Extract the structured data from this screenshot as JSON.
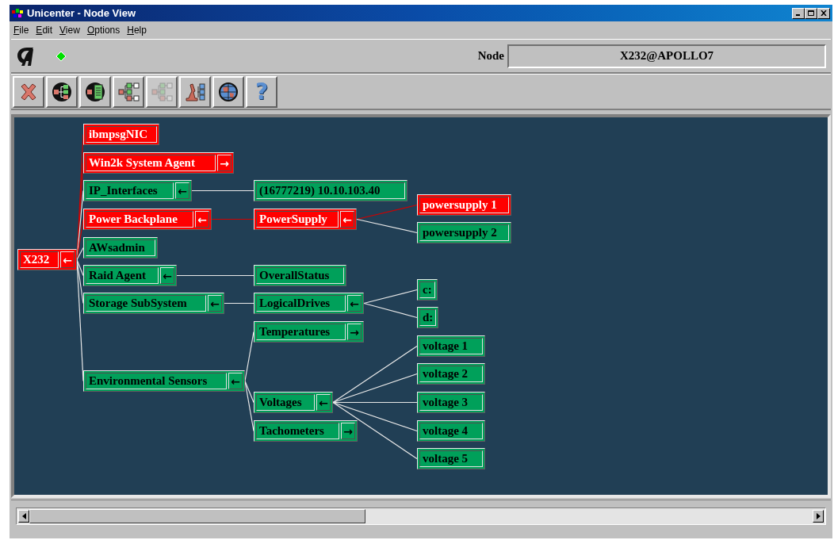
{
  "window": {
    "title": "Unicenter - Node View"
  },
  "menu": [
    "File",
    "Edit",
    "View",
    "Options",
    "Help"
  ],
  "node_field": {
    "label": "Node",
    "value": "X232@APOLLO7"
  },
  "toolbar": [
    {
      "kind": "close",
      "disabled": false
    },
    {
      "kind": "node-map",
      "disabled": false
    },
    {
      "kind": "node-detail",
      "disabled": false
    },
    {
      "kind": "tree",
      "disabled": false
    },
    {
      "kind": "tree",
      "disabled": true
    },
    {
      "kind": "microscope",
      "disabled": false
    },
    {
      "kind": "globe",
      "disabled": false
    },
    {
      "kind": "help",
      "label": "?",
      "disabled": false
    }
  ],
  "tree": {
    "label": "X232",
    "color": "#ff0000",
    "arrow": "←",
    "children": [
      {
        "label": "ibmpsgNIC",
        "color": "#ff0000"
      },
      {
        "label": "Win2k System Agent",
        "color": "#ff0000",
        "arrow": "→"
      },
      {
        "label": "IP_Interfaces",
        "color": "#00a05a",
        "arrow": "←",
        "children": [
          {
            "label": "(16777219) 10.10.103.40",
            "color": "#00a05a"
          }
        ]
      },
      {
        "label": "Power Backplane",
        "color": "#ff0000",
        "arrow": "←",
        "children": [
          {
            "label": "PowerSupply",
            "color": "#ff0000",
            "arrow": "←",
            "children": [
              {
                "label": "powersupply 1",
                "color": "#ff0000"
              },
              {
                "label": "powersupply 2",
                "color": "#00a05a"
              }
            ]
          }
        ]
      },
      {
        "label": "AWsadmin",
        "color": "#00a05a"
      },
      {
        "label": "Raid Agent",
        "color": "#00a05a",
        "arrow": "←",
        "children": [
          {
            "label": "OverallStatus",
            "color": "#00a05a"
          }
        ]
      },
      {
        "label": "Storage SubSystem",
        "color": "#00a05a",
        "arrow": "←",
        "children": [
          {
            "label": "LogicalDrives",
            "color": "#00a05a",
            "arrow": "←",
            "children": [
              {
                "label": "c:",
                "color": "#00a05a"
              },
              {
                "label": "d:",
                "color": "#00a05a"
              }
            ]
          }
        ]
      },
      {
        "label": "Environmental Sensors",
        "color": "#00a05a",
        "arrow": "←",
        "children": [
          {
            "label": "Temperatures",
            "color": "#00a05a",
            "arrow": "→"
          },
          {
            "label": "Voltages",
            "color": "#00a05a",
            "arrow": "←",
            "children": [
              {
                "label": "voltage  1",
                "color": "#00a05a"
              },
              {
                "label": "voltage  2",
                "color": "#00a05a"
              },
              {
                "label": "voltage  3",
                "color": "#00a05a"
              },
              {
                "label": "voltage  4",
                "color": "#00a05a"
              },
              {
                "label": "voltage  5",
                "color": "#00a05a"
              }
            ]
          },
          {
            "label": "Tachometers",
            "color": "#00a05a",
            "arrow": "→"
          }
        ]
      }
    ]
  }
}
